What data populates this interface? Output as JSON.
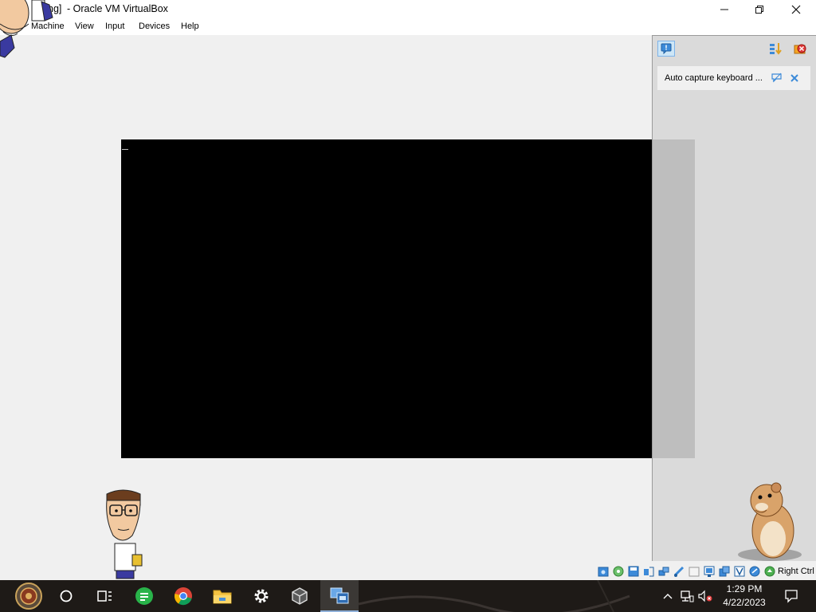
{
  "window": {
    "title_partial": "ng]",
    "title": "- Oracle VM VirtualBox",
    "title_prefix_bracket": "[",
    "minimize_label": "—",
    "maximize_label": "❐",
    "close_label": "✕"
  },
  "menu": {
    "items": [
      "Machine",
      "View",
      "Input",
      "Devices",
      "Help"
    ]
  },
  "notification": {
    "text": "Auto capture keyboard ..."
  },
  "statusbar": {
    "host_key": "Right Ctrl"
  },
  "taskbar": {
    "time": "1:29 PM",
    "date": "4/22/2023"
  },
  "colors": {
    "taskbar_bg": "#1e1a17",
    "vm_screen": "#000000",
    "accent": "#7eb4ea"
  }
}
